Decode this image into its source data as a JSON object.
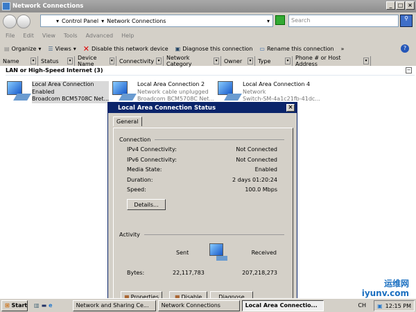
{
  "window": {
    "title": "Network Connections"
  },
  "address": {
    "crumbs": [
      "Control Panel",
      "Network Connections"
    ],
    "search_placeholder": "Search"
  },
  "menu": [
    "File",
    "Edit",
    "View",
    "Tools",
    "Advanced",
    "Help"
  ],
  "toolbar": {
    "organize": "Organize",
    "views": "Views",
    "disable": "Disable this network device",
    "diagnose": "Diagnose this connection",
    "rename": "Rename this connection",
    "more": "»"
  },
  "columns": [
    "Name",
    "Status",
    "Device Name",
    "Connectivity",
    "Network Category",
    "Owner",
    "Type",
    "Phone # or Host Address"
  ],
  "group": {
    "title": "LAN or High-Speed Internet (3)"
  },
  "connections": [
    {
      "name": "Local Area Connection",
      "status": "Enabled",
      "device": "Broadcom BCM5708C Net..."
    },
    {
      "name": "Local Area Connection 2",
      "status": "Network cable unplugged",
      "device": "Broadcom BCM5708C Net..."
    },
    {
      "name": "Local Area Connection 4",
      "status": "Network",
      "device": "Switch-SM-4a1c21fb-41dc..."
    }
  ],
  "dialog": {
    "title": "Local Area Connection Status",
    "tab": "General",
    "connection_label": "Connection",
    "rows": [
      {
        "k": "IPv4 Connectivity:",
        "v": "Not Connected"
      },
      {
        "k": "IPv6 Connectivity:",
        "v": "Not Connected"
      },
      {
        "k": "Media State:",
        "v": "Enabled"
      },
      {
        "k": "Duration:",
        "v": "2 days 01:20:24"
      },
      {
        "k": "Speed:",
        "v": "100.0 Mbps"
      }
    ],
    "details": "Details...",
    "activity_label": "Activity",
    "sent": "Sent",
    "received": "Received",
    "bytes_label": "Bytes:",
    "bytes_sent": "22,117,783",
    "bytes_received": "207,218,273",
    "properties": "Properties",
    "disable": "Disable",
    "diagnose": "Diagnose"
  },
  "taskbar": {
    "start": "Start",
    "tasks": [
      "Network and Sharing Ce...",
      "Network Connections",
      "Local Area Connectio..."
    ],
    "lang": "CH",
    "clock": "12:15 PM"
  },
  "watermark": {
    "line1": "运维网",
    "line2": "iyunv.com"
  }
}
